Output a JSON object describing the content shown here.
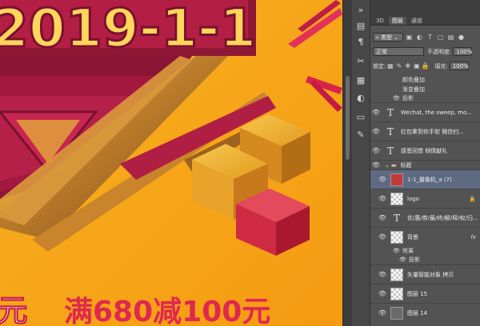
{
  "artwork": {
    "title_text": "2019-1-1",
    "promo_text": "满680减100元"
  },
  "panel": {
    "tabs": [
      "3D",
      "图层",
      "通道"
    ],
    "filter_select": "类型",
    "blend_mode": "正常",
    "opacity_label": "不透明度:",
    "opacity_value": "100%",
    "lock_label": "锁定:",
    "fill_label": "填充:",
    "fill_value": "100%",
    "effects_top": [
      "颜色叠加",
      "渐变叠加"
    ],
    "effect_shadow_top": "投影",
    "layers": [
      {
        "name": "Wechat, the sweep, mo..."
      },
      {
        "name": "红包拿到你手软  微信扫..."
      },
      {
        "name": "感恩回馈  倾情献礼"
      }
    ],
    "group_name": "标题",
    "layer_selected": "1-1_摄像机_a (7)",
    "layer_logo": "logo",
    "layer_text_long": "优/惠/券/最/终/解/释/权/归...",
    "layer_bg": "背景",
    "bg_effects_label": "效果",
    "bg_effect_shadow": "投影",
    "layer_smart": "矢量智能对象 拷贝",
    "layer_15": "图层 15",
    "layer_14": "图层 14"
  },
  "colors": {
    "canvas_bg": "#f6a818",
    "panel_bg": "#535353",
    "selected_row": "#5d6a82"
  }
}
